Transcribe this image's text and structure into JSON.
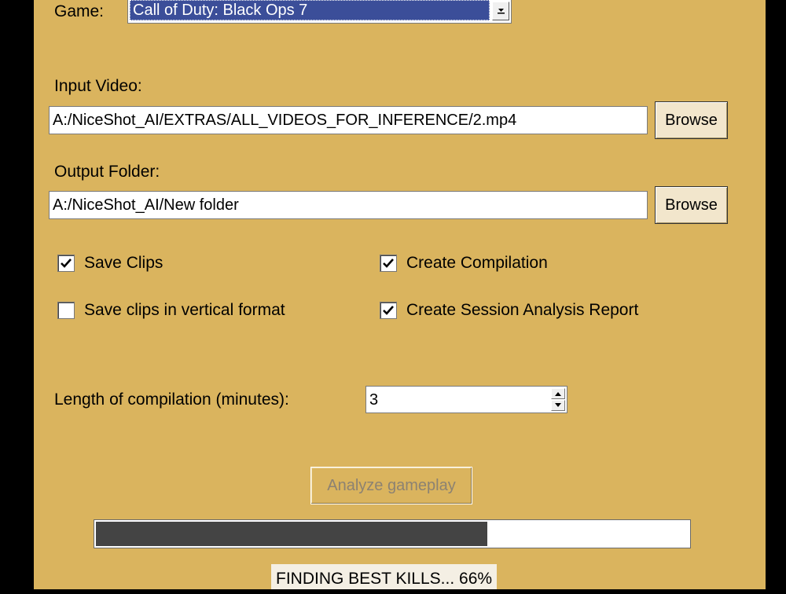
{
  "game": {
    "label": "Game:",
    "selected": "Call of Duty: Black Ops 7"
  },
  "input_video": {
    "label": "Input Video:",
    "value": "A:/NiceShot_AI/EXTRAS/ALL_VIDEOS_FOR_INFERENCE/2.mp4",
    "browse_label": "Browse"
  },
  "output_folder": {
    "label": "Output Folder:",
    "value": "A:/NiceShot_AI/New folder",
    "browse_label": "Browse"
  },
  "options": {
    "save_clips": {
      "label": "Save Clips",
      "checked": true
    },
    "create_compilation": {
      "label": "Create Compilation",
      "checked": true
    },
    "vertical_format": {
      "label": "Save clips in vertical format",
      "checked": false
    },
    "session_report": {
      "label": "Create Session Analysis Report",
      "checked": true
    }
  },
  "compilation_length": {
    "label": "Length of compilation (minutes):",
    "value": "3"
  },
  "analyze_button": {
    "label": "Analyze gameplay",
    "enabled": false
  },
  "progress": {
    "fraction": 0.66
  },
  "status": {
    "text": "FINDING BEST KILLS... 66%"
  },
  "colors": {
    "background": "#dab45e",
    "progress_fill": "#444444",
    "selection": "#3b4e99"
  }
}
